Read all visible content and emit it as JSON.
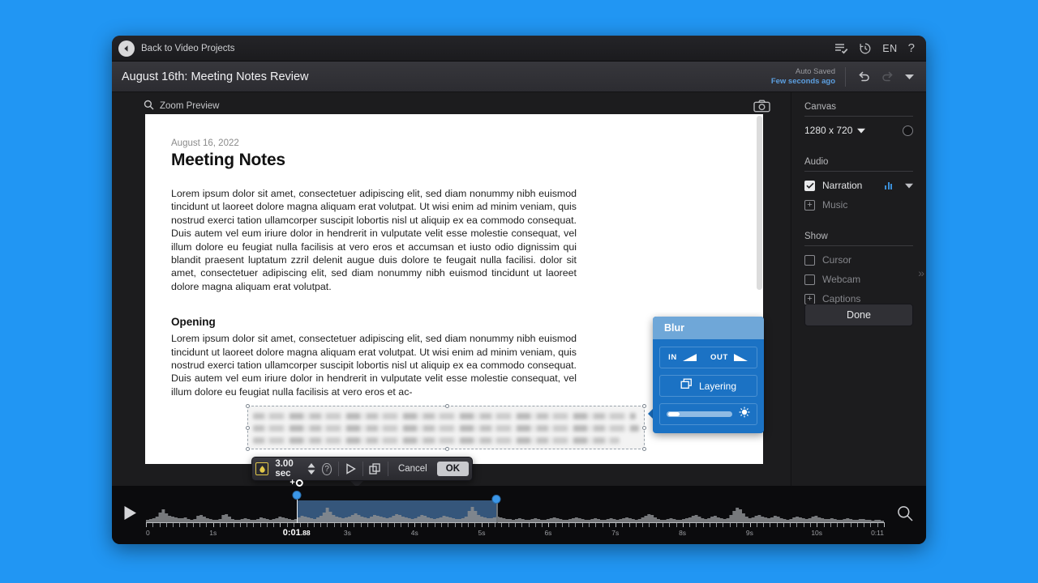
{
  "titlebar": {
    "back_label": "Back to Video Projects",
    "back_icon": "back-arrow-icon",
    "list_icon": "checklist-icon",
    "history_icon": "history-clock-icon",
    "language": "EN",
    "help": "?"
  },
  "projectbar": {
    "title": "August 16th: Meeting Notes Review",
    "autosave_title": "Auto Saved",
    "autosave_time": "Few seconds ago",
    "undo_icon": "undo-icon",
    "redo_icon": "redo-icon",
    "caret_icon": "chevron-down-icon"
  },
  "preview": {
    "zoom_label": "Zoom Preview",
    "search_icon": "search-icon",
    "camera_icon": "camera-icon"
  },
  "document": {
    "date": "August 16, 2022",
    "heading": "Meeting Notes",
    "paragraph1": "Lorem ipsum dolor sit amet, consectetuer adipiscing elit, sed diam nonummy nibh euismod tincidunt ut laoreet dolore magna aliquam erat volutpat. Ut wisi enim ad minim veniam, quis nostrud exerci tation ullamcorper suscipit lobortis nisl ut aliquip ex ea commodo consequat. Duis autem vel eum iriure dolor in hendrerit in vulputate velit esse molestie consequat, vel illum dolore eu feugiat nulla facilisis at vero eros et accumsan et iusto odio dignissim qui blandit praesent luptatum zzril delenit augue duis dolore te feugait nulla facilisi. dolor sit amet, consectetuer adipiscing elit, sed diam nonummy nibh euismod tincidunt ut laoreet dolore magna aliquam erat volutpat.",
    "subheading": "Opening",
    "paragraph2": "Lorem ipsum dolor sit amet, consectetuer adipiscing elit, sed diam nonummy nibh euismod tincidunt ut laoreet dolore magna aliquam erat volutpat. Ut wisi enim ad minim veniam, quis nostrud exerci tation ullamcorper suscipit lobortis nisl ut aliquip ex ea commodo consequat. Duis autem vel eum iriure dolor in hendrerit in vulputate velit esse molestie consequat, vel illum dolore eu feugiat nulla facilisis at vero eros et ac-"
  },
  "blur_popover": {
    "title": "Blur",
    "in_label": "IN",
    "out_label": "OUT",
    "layering_label": "Layering",
    "layering_icon": "layers-icon",
    "intensity_icon": "blur-intensity-icon",
    "accent_color": "#1b72c4",
    "header_color": "#6fa7d8"
  },
  "duration_toolbar": {
    "effect_icon": "blur-swatch-icon",
    "duration": "3.00 sec",
    "stepper_icon": "stepper-up-down-icon",
    "help_icon": "question-mark-icon",
    "preview_icon": "play-icon",
    "duplicate_icon": "duplicate-icon",
    "cancel_label": "Cancel",
    "ok_label": "OK"
  },
  "sidebar": {
    "canvas_heading": "Canvas",
    "canvas_resolution": "1280 x 720",
    "canvas_caret": "chevron-down-icon",
    "canvas_color_swatch": "color-circle-icon",
    "audio_heading": "Audio",
    "audio_items": [
      {
        "label": "Narration",
        "checked": true,
        "icon": "audio-levels-icon",
        "caret": "chevron-down-icon"
      },
      {
        "label": "Music",
        "checked": false,
        "icon": "plus-icon"
      }
    ],
    "show_heading": "Show",
    "show_items": [
      {
        "label": "Cursor",
        "checked": false,
        "type": "checkbox"
      },
      {
        "label": "Webcam",
        "checked": false,
        "type": "checkbox"
      },
      {
        "label": "Captions",
        "checked": false,
        "type": "plus"
      }
    ],
    "done_label": "Done",
    "expand_icon": "chevrons-right-icon"
  },
  "timeline": {
    "play_icon": "play-icon",
    "zoom_icon": "search-icon",
    "playhead_time": "0:01",
    "playhead_frames": ".88",
    "add_keyframe_icon": "add-keyframe-icon",
    "selection_start_pct": 20.4,
    "selection_end_pct": 47.5,
    "ticks": [
      {
        "label": "0",
        "pct": 0
      },
      {
        "label": "1s",
        "pct": 9.1
      },
      {
        "label": "3s",
        "pct": 27.3
      },
      {
        "label": "4s",
        "pct": 36.4
      },
      {
        "label": "5s",
        "pct": 45.5
      },
      {
        "label": "6s",
        "pct": 54.5
      },
      {
        "label": "7s",
        "pct": 63.6
      },
      {
        "label": "8s",
        "pct": 72.7
      },
      {
        "label": "9s",
        "pct": 81.8
      },
      {
        "label": "10s",
        "pct": 90.9
      },
      {
        "label": "0:11",
        "pct": 100
      }
    ],
    "waveform": [
      3,
      4,
      5,
      7,
      12,
      16,
      11,
      8,
      7,
      6,
      5,
      5,
      6,
      4,
      3,
      4,
      8,
      9,
      7,
      5,
      4,
      3,
      3,
      4,
      9,
      10,
      7,
      4,
      3,
      3,
      4,
      5,
      4,
      3,
      3,
      4,
      6,
      5,
      4,
      3,
      4,
      5,
      7,
      6,
      5,
      4,
      3,
      4,
      6,
      8,
      7,
      6,
      5,
      4,
      6,
      8,
      12,
      18,
      13,
      9,
      7,
      6,
      5,
      6,
      7,
      9,
      11,
      9,
      7,
      6,
      5,
      7,
      9,
      8,
      7,
      6,
      5,
      6,
      8,
      10,
      9,
      7,
      6,
      5,
      4,
      5,
      7,
      9,
      8,
      6,
      5,
      4,
      5,
      6,
      8,
      7,
      6,
      5,
      4,
      4,
      5,
      7,
      14,
      19,
      14,
      9,
      7,
      6,
      5,
      5,
      6,
      7,
      6,
      5,
      4,
      4,
      3,
      4,
      5,
      4,
      3,
      3,
      4,
      5,
      4,
      3,
      3,
      4,
      5,
      6,
      5,
      4,
      3,
      3,
      4,
      5,
      6,
      5,
      4,
      3,
      3,
      4,
      5,
      4,
      3,
      3,
      4,
      5,
      4,
      3,
      4,
      5,
      6,
      5,
      4,
      3,
      4,
      6,
      8,
      10,
      9,
      6,
      4,
      3,
      3,
      4,
      5,
      4,
      3,
      3,
      4,
      5,
      6,
      8,
      9,
      7,
      5,
      4,
      5,
      7,
      8,
      6,
      5,
      4,
      5,
      9,
      14,
      18,
      16,
      11,
      7,
      5,
      6,
      8,
      9,
      7,
      6,
      5,
      6,
      8,
      7,
      5,
      4,
      3,
      4,
      6,
      7,
      6,
      5,
      4,
      5,
      7,
      8,
      6,
      5,
      4,
      4,
      5,
      4,
      3,
      3,
      4,
      5,
      4,
      3,
      3,
      4,
      4,
      3,
      3,
      2,
      3,
      3,
      2
    ]
  }
}
